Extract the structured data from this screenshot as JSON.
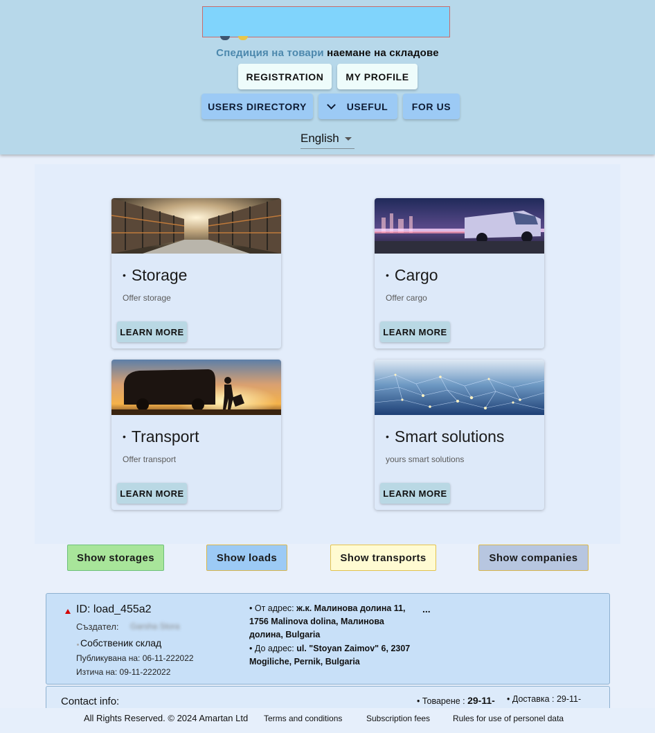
{
  "header": {
    "tagline_accent": "Спедиция на товари",
    "tagline_rest": "наемане на складове",
    "nav": {
      "registration": "REGISTRATION",
      "my_profile": "MY PROFILE",
      "users_directory": "USERS DIRECTORY",
      "useful": "USEFUL",
      "for_us": "FOR US"
    },
    "language": "English"
  },
  "cards": [
    {
      "title": "Storage",
      "subtitle": "Offer storage",
      "button": "LEARN MORE"
    },
    {
      "title": "Cargo",
      "subtitle": "Offer cargo",
      "button": "LEARN MORE"
    },
    {
      "title": "Transport",
      "subtitle": "Offer transport",
      "button": "LEARN MORE"
    },
    {
      "title": "Smart solutions",
      "subtitle": "yours smart solutions",
      "button": "LEARN MORE"
    }
  ],
  "filters": {
    "storages": "Show storages",
    "loads": "Show loads",
    "transports": "Show transports",
    "companies": "Show companies"
  },
  "listing": {
    "id": "ID: load_455a2",
    "creator_label": "Създател:",
    "creator_name": "Garsha Stora",
    "role": "Собственик склад",
    "published": "Публикувана на: 06-11-222022",
    "expires": "Изтича на: 09-11-222022",
    "from_label": "• От адрес:",
    "from_value": "ж.к. Малинова долина 11, 1756 Malinova dolina, Малинова долина, Bulgaria",
    "to_label": "• До адрес:",
    "to_value": "ul. \"Stoyan Zaimov\" 6, 2307 Mogiliche, Pernik, Bulgaria",
    "more": "..."
  },
  "contact": {
    "title": "Contact info:",
    "loading_label": "• Товарене :",
    "loading_value": "29-11-",
    "delivery_label": "• Доставка :",
    "delivery_value": "29-11-"
  },
  "footer": {
    "copyright": "All Rights Reserved. © 2024 Amartan Ltd",
    "terms": "Terms and conditions",
    "fees": "Subscription fees",
    "rules": "Rules for use of personel data"
  },
  "colors": {
    "header_bg": "#b7d8ea",
    "page_bg": "#e9f0fb",
    "nav_blue": "#9ccaf5",
    "nav_light": "#eefcfb",
    "storages_btn": "#a8e59a",
    "loads_btn": "#9ccaf5",
    "transports_btn": "#fffbd2",
    "companies_btn": "#b7c6e0"
  }
}
